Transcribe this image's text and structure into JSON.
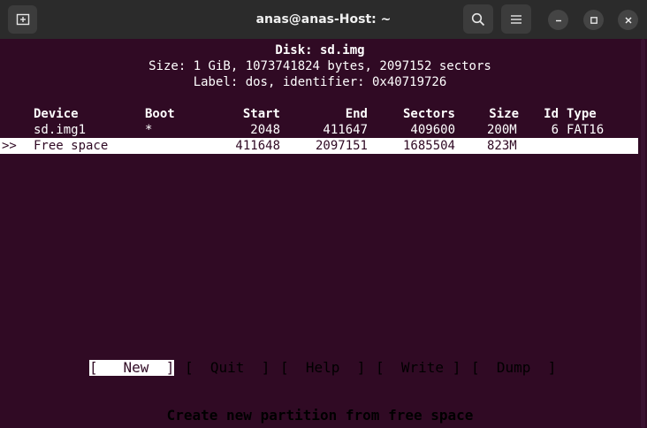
{
  "window": {
    "title": "anas@anas-Host: ~",
    "new_tab_icon": "new-tab-icon",
    "search_icon": "search-icon",
    "menu_icon": "hamburger-icon"
  },
  "disk": {
    "header": "Disk: sd.img",
    "size_line": "Size: 1 GiB, 1073741824 bytes, 2097152 sectors",
    "label_line": "Label: dos, identifier: 0x40719726"
  },
  "table": {
    "headers": {
      "device": "Device",
      "boot": "Boot",
      "start": "Start",
      "end": "End",
      "sectors": "Sectors",
      "size": "Size",
      "id": "Id",
      "type": "Type"
    },
    "rows": [
      {
        "marker": "",
        "device": "sd.img1",
        "boot": "*",
        "start": "2048",
        "end": "411647",
        "sectors": "409600",
        "size": "200M",
        "id": "6",
        "type": "FAT16"
      },
      {
        "marker": ">>",
        "device": "Free space",
        "boot": "",
        "start": "411648",
        "end": "2097151",
        "sectors": "1685504",
        "size": "823M",
        "id": "",
        "type": ""
      }
    ]
  },
  "menu": {
    "items": [
      "[   New  ]",
      "[  Quit  ]",
      "[  Help  ]",
      "[  Write ]",
      "[  Dump  ]"
    ],
    "selected": "New"
  },
  "status": "Create new partition from free space",
  "colors": {
    "terminal_bg": "#300a24",
    "text": "#ffffff",
    "titlebar": "#2b2b2b"
  }
}
